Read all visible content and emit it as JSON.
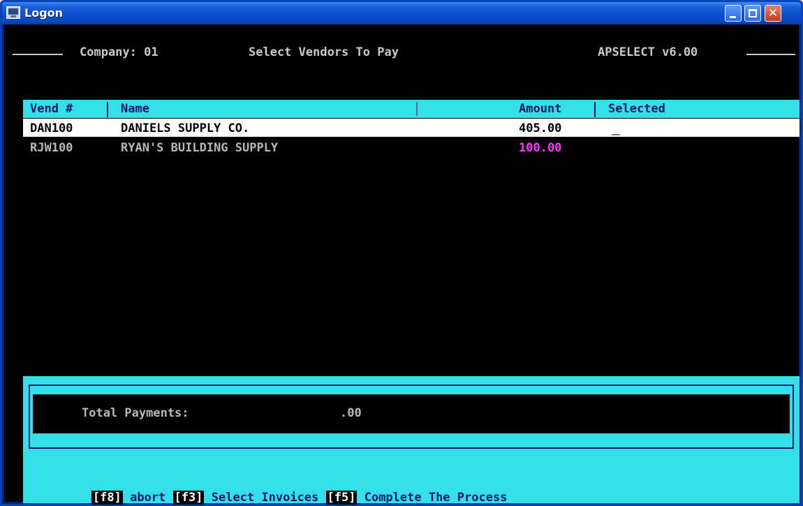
{
  "window": {
    "title": "Logon",
    "icon": "terminal-app-icon",
    "controls": [
      "minimize-icon",
      "maximize-icon",
      "close-icon"
    ]
  },
  "header": {
    "company": "Company: 01",
    "screen_title": "Select Vendors To Pay",
    "program": "APSELECT v6.00"
  },
  "table": {
    "columns": [
      "Vend #",
      "Name",
      "Amount",
      "Selected"
    ],
    "rows": [
      {
        "vend": "DAN100",
        "name": "DANIELS SUPPLY CO.",
        "amount": "405.00",
        "selected": "",
        "highlighted": true
      },
      {
        "vend": "RJW100",
        "name": "RYAN'S BUILDING SUPPLY",
        "amount": "100.00",
        "selected": "",
        "amount_color": "#ff33ff"
      }
    ]
  },
  "totals": {
    "label": "Total Payments:",
    "value": ".00"
  },
  "function_keys": [
    {
      "key": "[f8]",
      "label": "abort"
    },
    {
      "key": "[f3]",
      "label": "Select Invoices"
    },
    {
      "key": "[f5]",
      "label": "Complete The Process"
    }
  ],
  "colors": {
    "terminal_bg": "#000000",
    "cyan_bar": "#33e0ea",
    "text_dark_blue": "#081868",
    "magenta_amount": "#ff33ff"
  }
}
